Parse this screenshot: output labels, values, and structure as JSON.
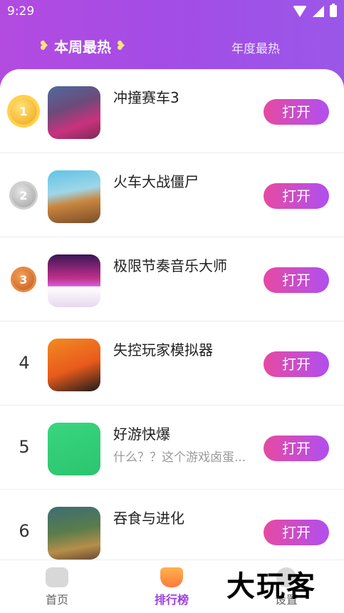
{
  "status_bar": {
    "time": "9:29"
  },
  "tabs": {
    "weekly": "本周最热",
    "yearly": "年度最热"
  },
  "ranking": [
    {
      "rank": "1",
      "rank_display": "medal",
      "title": "冲撞赛车3",
      "desc": "",
      "button": "打开"
    },
    {
      "rank": "2",
      "rank_display": "medal",
      "title": "火车大战僵尸",
      "desc": "",
      "button": "打开"
    },
    {
      "rank": "3",
      "rank_display": "medal",
      "title": "极限节奏音乐大师",
      "desc": "",
      "button": "打开"
    },
    {
      "rank": "4",
      "rank_display": "number",
      "title": "失控玩家模拟器",
      "desc": "",
      "button": "打开"
    },
    {
      "rank": "5",
      "rank_display": "number",
      "title": "好游快爆",
      "desc": "什么？？这个游戏卤蛋...",
      "button": "打开"
    },
    {
      "rank": "6",
      "rank_display": "number",
      "title": "吞食与进化",
      "desc": "",
      "button": "打开"
    }
  ],
  "bottom_nav": {
    "home": "首页",
    "rank": "排行榜",
    "settings": "设置"
  },
  "watermark": "大玩客",
  "colors": {
    "header": "#a44ce6",
    "accent": "#9b3fe0",
    "button_start": "#e64aa2",
    "button_end": "#b04ff0"
  }
}
